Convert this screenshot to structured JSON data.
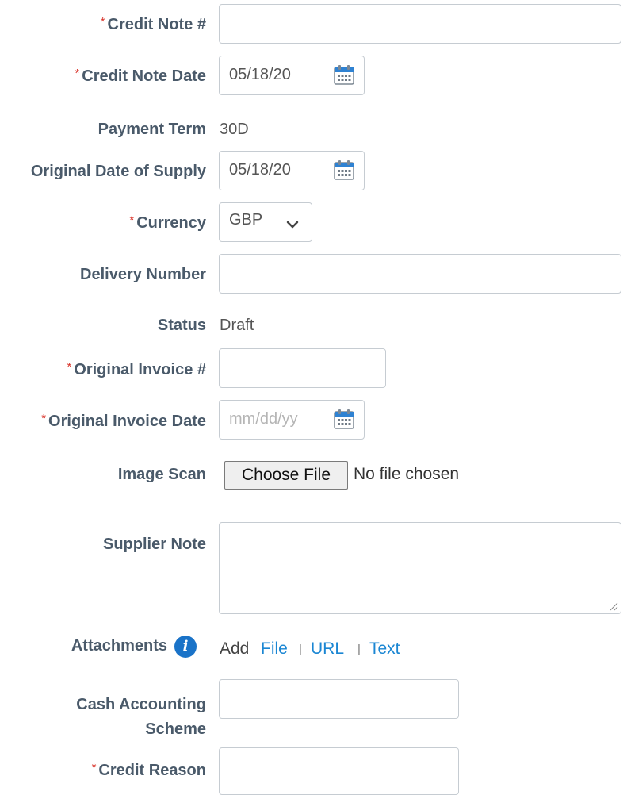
{
  "fields": {
    "credit_note_no": {
      "label": "Credit Note #",
      "required": "*"
    },
    "credit_note_date": {
      "label": "Credit Note Date",
      "required": "*",
      "value": "05/18/20"
    },
    "payment_term": {
      "label": "Payment Term",
      "value": "30D"
    },
    "original_date_supply": {
      "label": "Original Date of Supply",
      "value": "05/18/20"
    },
    "currency": {
      "label": "Currency",
      "required": "*",
      "value": "GBP"
    },
    "delivery_number": {
      "label": "Delivery Number"
    },
    "status": {
      "label": "Status",
      "value": "Draft"
    },
    "original_invoice_no": {
      "label": "Original Invoice #",
      "required": "*"
    },
    "original_invoice_date": {
      "label": "Original Invoice Date",
      "required": "*",
      "placeholder": "mm/dd/yy"
    },
    "image_scan": {
      "label": "Image Scan",
      "button": "Choose File",
      "status": "No file chosen"
    },
    "supplier_note": {
      "label": "Supplier Note"
    },
    "attachments": {
      "label": "Attachments",
      "add": "Add",
      "file": "File",
      "url": "URL",
      "text": "Text"
    },
    "cash_accounting": {
      "label_line1": "Cash Accounting",
      "label_line2": "Scheme"
    },
    "credit_reason": {
      "label": "Credit Reason",
      "required": "*"
    }
  },
  "separator": "|",
  "colors": {
    "required": "#d9342b",
    "link": "#1a86d3",
    "info_icon": "#1a73c8",
    "label": "#4a5a6a"
  }
}
